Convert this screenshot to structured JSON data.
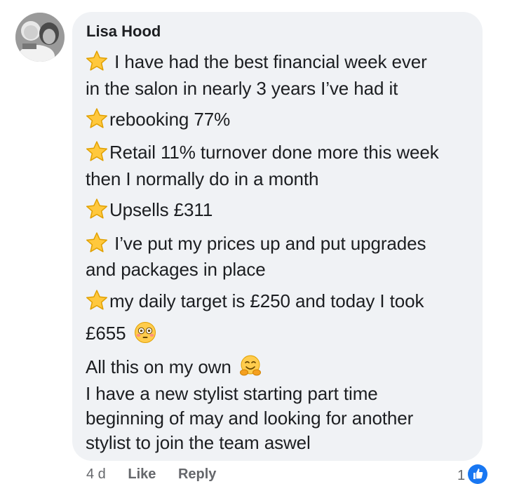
{
  "comment": {
    "author": "Lisa Hood",
    "lines": [
      "I have had the best financial week ever",
      "in the salon in nearly 3 years I’ve had it",
      "rebooking 77%",
      "Retail 11% turnover done more this week",
      "then I normally do in a month",
      "Upsells £311",
      "I’ve put my prices up and put upgrades",
      "and packages in place",
      "my daily target is £250 and today I took",
      "£655",
      "All this on my own",
      "I have a new stylist starting part time",
      "beginning of may and looking for another",
      "stylist to join the team aswel"
    ]
  },
  "footer": {
    "time": "4 d",
    "like_label": "Like",
    "reply_label": "Reply",
    "reaction_count": "1"
  },
  "icons": {
    "star": "star-emoji",
    "flushed": "flushed-face-emoji",
    "hugging": "hugging-face-emoji",
    "like": "thumbs-up-icon"
  },
  "colors": {
    "bubble": "#f0f2f5",
    "text": "#1c1e21",
    "meta": "#65676b",
    "like_blue": "#1877f2",
    "star_fill": "#ffc83d"
  }
}
